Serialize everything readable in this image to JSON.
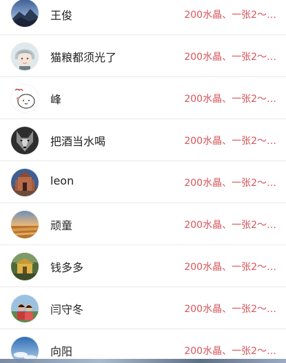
{
  "contacts": [
    {
      "name": "王俊",
      "offer": "200水晶、一张2～…",
      "avatar_icon": "mountain-dusk-avatar"
    },
    {
      "name": "猫粮都须光了",
      "offer": "200水晶、一张2～…",
      "avatar_icon": "anime-boy-avatar"
    },
    {
      "name": "峰",
      "offer": "200水晶、一张2～…",
      "avatar_icon": "doodle-bun-avatar"
    },
    {
      "name": "把酒当水喝",
      "offer": "200水晶、一张2～…",
      "avatar_icon": "wolf-avatar"
    },
    {
      "name": "leon",
      "offer": "200水晶、一张2～…",
      "avatar_icon": "cathedral-avatar"
    },
    {
      "name": "顽童",
      "offer": "200水晶、一张2～…",
      "avatar_icon": "field-sunset-avatar"
    },
    {
      "name": "钱多多",
      "offer": "200水晶、一张2～…",
      "avatar_icon": "temple-avatar"
    },
    {
      "name": "闫守冬",
      "offer": "200水晶、一张2～…",
      "avatar_icon": "couple-photo-avatar"
    },
    {
      "name": "向阳",
      "offer": "200水晶、一张2～…",
      "avatar_icon": "sky-avatar"
    }
  ],
  "colors": {
    "offer_text": "#d8545a",
    "name_text": "#222222",
    "divider": "#e9e9e9"
  }
}
